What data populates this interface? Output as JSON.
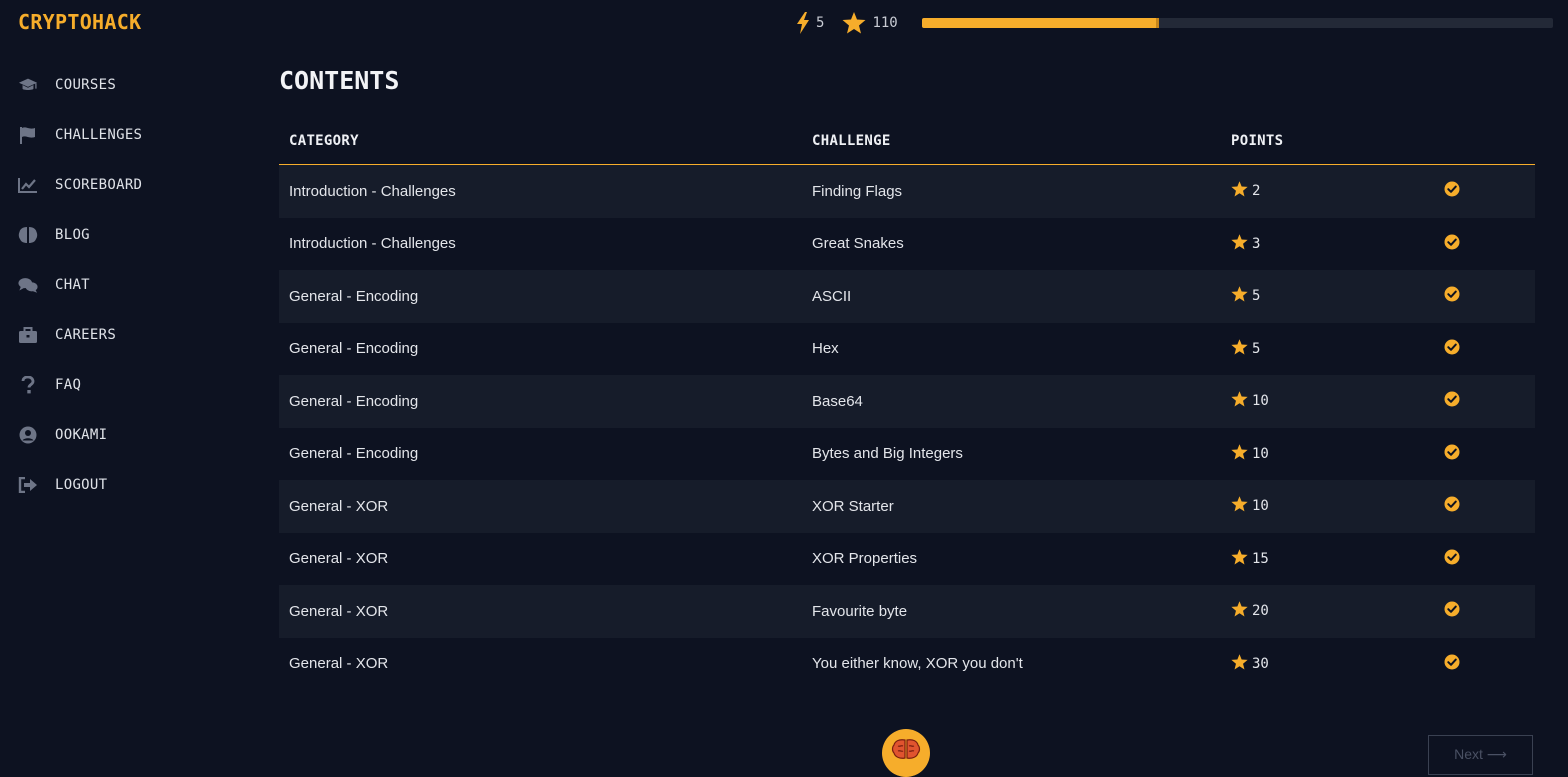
{
  "app": {
    "logo": "CRYPTOHACK",
    "accent_color": "#f6ad2b",
    "background_color": "#0d1221"
  },
  "topbar": {
    "streak": "5",
    "points": "110",
    "progress_fraction": 0.375
  },
  "sidebar": {
    "items": [
      {
        "label": "COURSES",
        "icon": "graduation-cap-icon"
      },
      {
        "label": "CHALLENGES",
        "icon": "flag-icon"
      },
      {
        "label": "SCOREBOARD",
        "icon": "chart-line-icon"
      },
      {
        "label": "BLOG",
        "icon": "brain-icon"
      },
      {
        "label": "CHAT",
        "icon": "chat-bubbles-icon"
      },
      {
        "label": "CAREERS",
        "icon": "briefcase-icon"
      },
      {
        "label": "FAQ",
        "icon": "question-icon"
      },
      {
        "label": "OOKAMI",
        "icon": "user-circle-icon"
      },
      {
        "label": "LOGOUT",
        "icon": "sign-out-icon"
      }
    ]
  },
  "main": {
    "title": "CONTENTS",
    "table": {
      "headers": [
        "CATEGORY",
        "CHALLENGE",
        "POINTS"
      ],
      "rows": [
        {
          "category": "Introduction - Challenges",
          "challenge": "Finding Flags",
          "points": "2",
          "solved": true
        },
        {
          "category": "Introduction - Challenges",
          "challenge": "Great Snakes",
          "points": "3",
          "solved": true
        },
        {
          "category": "General - Encoding",
          "challenge": "ASCII",
          "points": "5",
          "solved": true
        },
        {
          "category": "General - Encoding",
          "challenge": "Hex",
          "points": "5",
          "solved": true
        },
        {
          "category": "General - Encoding",
          "challenge": "Base64",
          "points": "10",
          "solved": true
        },
        {
          "category": "General - Encoding",
          "challenge": "Bytes and Big Integers",
          "points": "10",
          "solved": true
        },
        {
          "category": "General - XOR",
          "challenge": "XOR Starter",
          "points": "10",
          "solved": true
        },
        {
          "category": "General - XOR",
          "challenge": "XOR Properties",
          "points": "15",
          "solved": true
        },
        {
          "category": "General - XOR",
          "challenge": "Favourite byte",
          "points": "20",
          "solved": true
        },
        {
          "category": "General - XOR",
          "challenge": "You either know, XOR you don't",
          "points": "30",
          "solved": true
        }
      ]
    },
    "next_label": "Next ⟶"
  }
}
